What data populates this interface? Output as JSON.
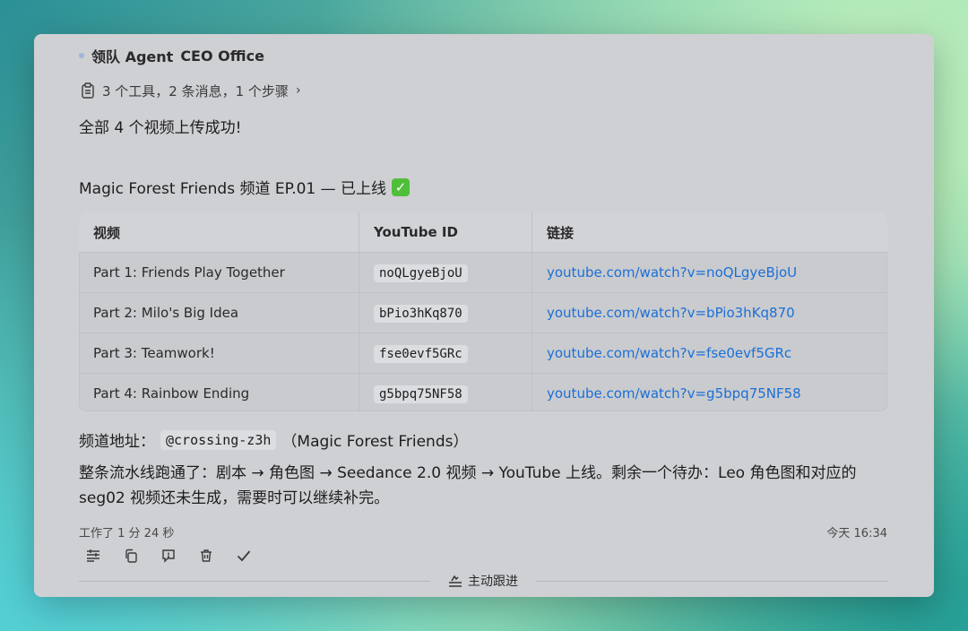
{
  "header": {
    "agent_name": "领队 Agent",
    "office": "CEO Office",
    "steps_summary": "3 个工具，2 条消息，1 个步骤",
    "chevron": "›"
  },
  "message": {
    "intro": "全部 4 个视频上传成功!",
    "section_title": "Magic Forest Friends 频道 EP.01 — 已上线",
    "section_emoji": "✓",
    "table": {
      "headers": [
        "视频",
        "YouTube ID",
        "链接"
      ],
      "rows": [
        {
          "video": "Part 1: Friends Play Together",
          "id": "noQLgyeBjoU",
          "link": "youtube.com/watch?v=noQLgyeBjoU"
        },
        {
          "video": "Part 2: Milo's Big Idea",
          "id": "bPio3hKq870",
          "link": "youtube.com/watch?v=bPio3hKq870"
        },
        {
          "video": "Part 3: Teamwork!",
          "id": "fse0evf5GRc",
          "link": "youtube.com/watch?v=fse0evf5GRc"
        },
        {
          "video": "Part 4: Rainbow Ending",
          "id": "g5bpq75NF58",
          "link": "youtube.com/watch?v=g5bpq75NF58"
        }
      ]
    },
    "channel_label": "频道地址：",
    "channel_handle": "@crossing-z3h",
    "channel_name": "（Magic Forest Friends）",
    "pipeline": "整条流水线跑通了：剧本 → 角色图 → Seedance 2.0 视频 → YouTube 上线。剩余一个待办：Leo 角色图和对应的 seg02 视频还未生成，需要时可以继续补完。"
  },
  "meta": {
    "worked": "工作了 1 分 24 秒",
    "time": "今天 16:34"
  },
  "follow": {
    "label": "主动跟进"
  },
  "colors": {
    "link": "#1a6fd8",
    "check": "#4fbf3a"
  }
}
